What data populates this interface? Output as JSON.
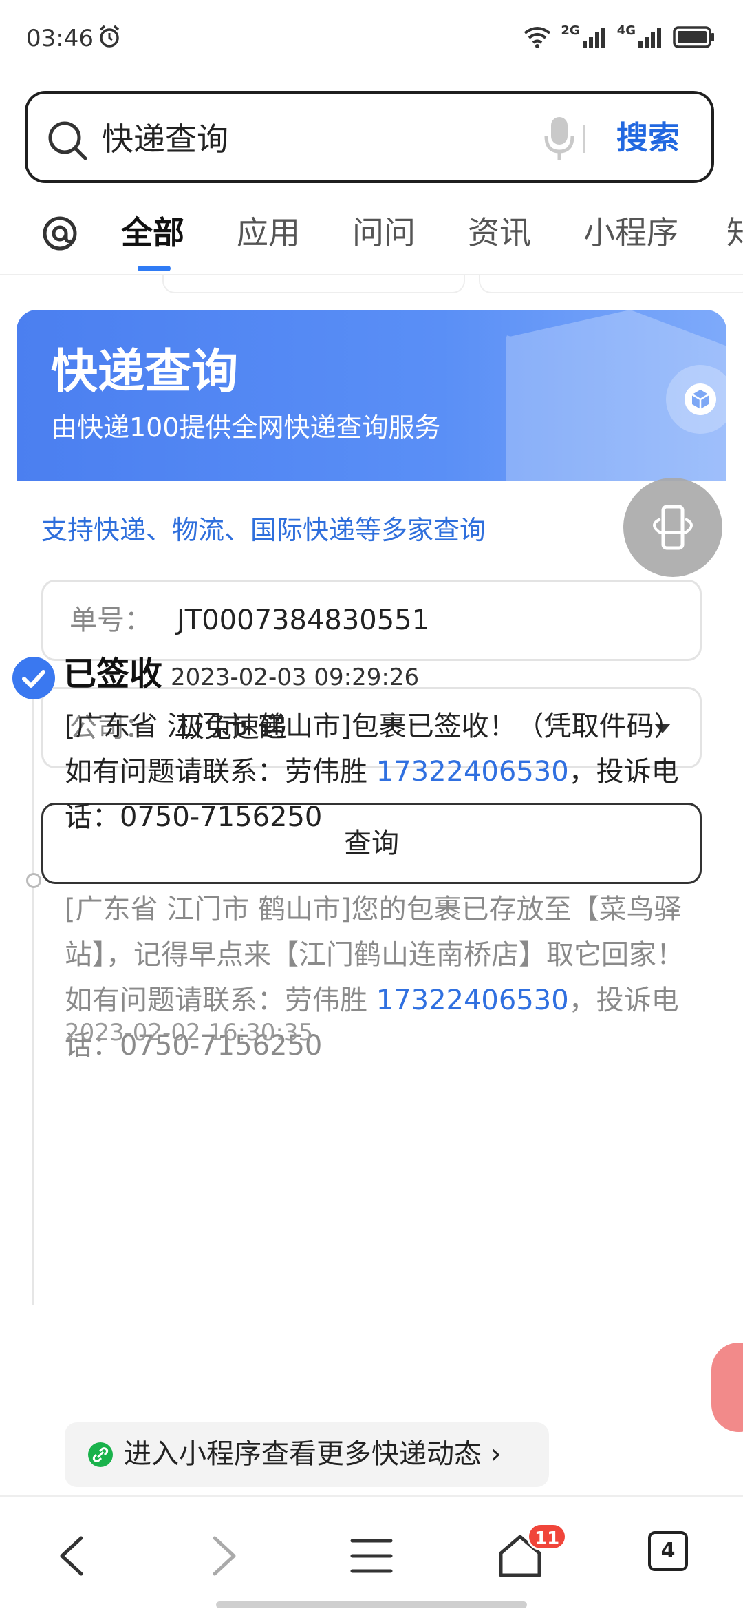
{
  "status_bar": {
    "time": "03:46",
    "net_1": "2G",
    "net_2": "4G"
  },
  "search": {
    "query": "快递查询",
    "button_label": "搜索"
  },
  "tabs": [
    {
      "label": "全部",
      "active": true
    },
    {
      "label": "应用",
      "active": false
    },
    {
      "label": "问问",
      "active": false
    },
    {
      "label": "资讯",
      "active": false
    },
    {
      "label": "小程序",
      "active": false
    },
    {
      "label": "知",
      "active": false
    }
  ],
  "card": {
    "title": "快递查询",
    "subtitle": "由快递100提供全网快递查询服务",
    "support_text": "支持快递、物流、国际快递等多家查询",
    "tracking_label": "单号：",
    "tracking_number": "JT0007384830551",
    "company_label": "公司：",
    "company_value": "极兔速递",
    "query_button": "查询"
  },
  "timeline": {
    "status": "已签收",
    "status_time": "2023-02-03 09:29:26",
    "entry_1": {
      "before_phone": "[广东省 江门市 鹤山市]包裹已签收！（凭取件码）如有问题请联系：劳伟胜 ",
      "phone": "17322406530",
      "after_phone": "，投诉电话：0750-7156250"
    },
    "entry_2": {
      "before_phone": "[广东省 江门市 鹤山市]您的包裹已存放至【菜鸟驿站】，记得早点来【江门鹤山连南桥店】取它回家！如有问题请联系：劳伟胜 ",
      "phone": "17322406530",
      "after_phone": "，投诉电话：0750-7156250",
      "time": "2023-02-02 16:30:35"
    },
    "mini_program_label": "进入小程序查看更多快递动态",
    "mini_program_chevron": "›"
  },
  "bottom_nav": {
    "home_badge": "11",
    "tab_count": "4"
  },
  "colors": {
    "accent": "#2268e0",
    "header_blue": "#4b7ff0",
    "link_blue": "#3070e0",
    "badge_red": "#f0453a"
  }
}
